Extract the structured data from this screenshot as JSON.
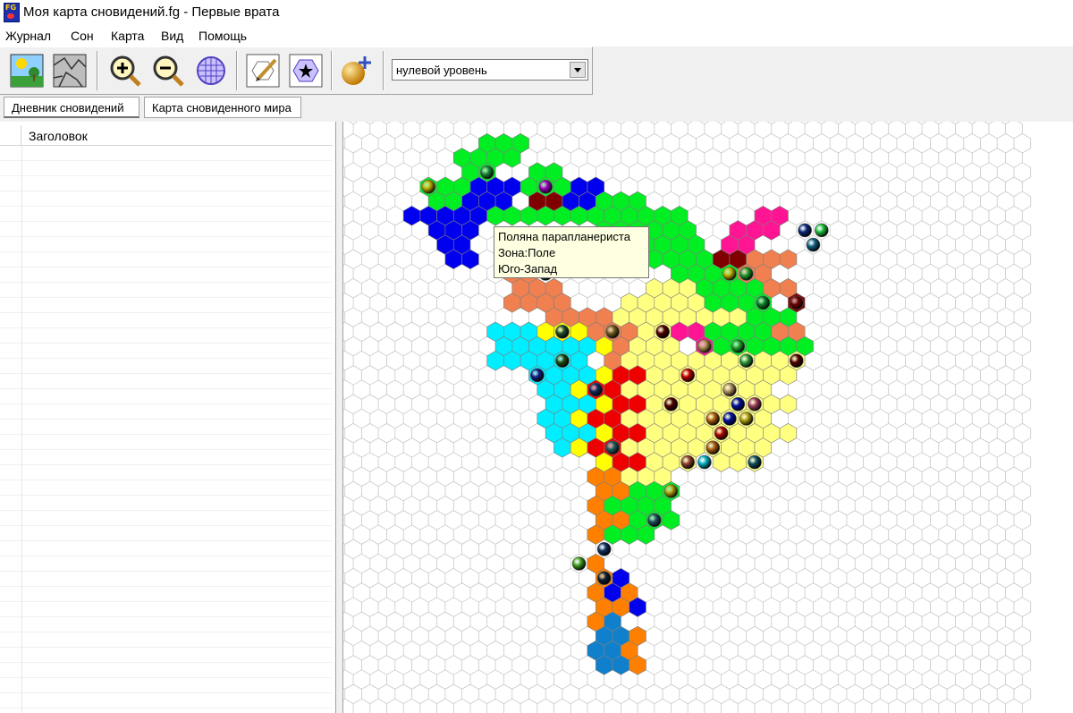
{
  "window": {
    "title": "Моя карта сновидений.fg - Первые врата",
    "icon": "fg-app-icon"
  },
  "menu": {
    "items": [
      "Журнал",
      "Сон",
      "Карта",
      "Вид",
      "Помощь"
    ]
  },
  "toolbar": {
    "buttons": [
      {
        "name": "landscape-day-icon"
      },
      {
        "name": "landscape-stone-icon"
      },
      {
        "name": "zoom-in-icon"
      },
      {
        "name": "zoom-out-icon"
      },
      {
        "name": "hex-grid-icon"
      },
      {
        "name": "edit-pen-icon"
      },
      {
        "name": "hex-star-icon"
      },
      {
        "name": "add-point-icon"
      }
    ],
    "level_value": "нулевой уровень"
  },
  "tabs": [
    {
      "label": "Дневник сновидений",
      "active": false
    },
    {
      "label": "Карта сновиденного мира",
      "active": true
    }
  ],
  "list": {
    "column_header": "Заголовок"
  },
  "tooltip": {
    "lines": [
      "Поляна парапланериста",
      "Зона:Поле",
      "Юго-Запад"
    ]
  },
  "colors": {
    "grid_line": "#c8c8c8",
    "forest": "#00ee22",
    "water": "#0000ee",
    "field": "#ffff80",
    "desert": "#ffff00",
    "fire": "#ee0000",
    "ice": "#00eeff",
    "clay": "#f08050",
    "orange": "#ff8000",
    "dark_red": "#800000",
    "pink": "#ff1493",
    "steel_blue": "#1080cc"
  }
}
